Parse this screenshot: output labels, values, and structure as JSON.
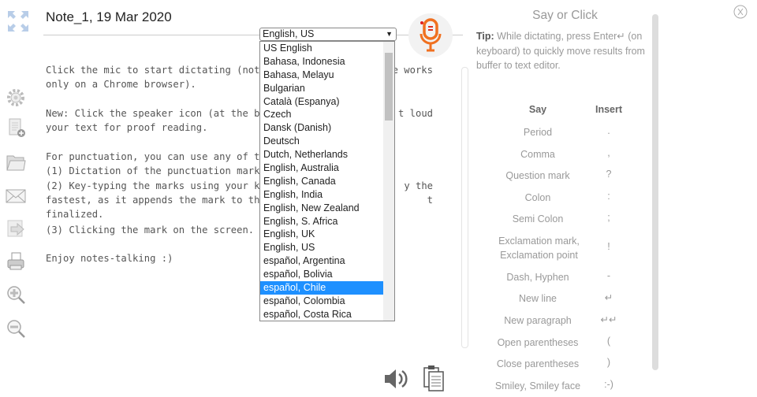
{
  "note": {
    "title": "Note_1, 19 Mar 2020",
    "lines": [
      {
        "l": "Click the mic to start dictating (not",
        "r": "e works"
      },
      {
        "l": "only on a Chrome browser).",
        "r": ""
      },
      {
        "l": "New: Click the speaker icon (at the b",
        "r": "t loud"
      },
      {
        "l": "your text for proof reading.",
        "r": ""
      },
      {
        "l": "For punctuation, you can use any of t",
        "r": ""
      },
      {
        "l": "(1) Dictation of the punctuation mark",
        "r": ""
      },
      {
        "l": "(2) Key-typing the marks using your k",
        "r": "y the"
      },
      {
        "l": "fastest, as it appends the mark to th",
        "r": "t"
      },
      {
        "l": "finalized.",
        "r": ""
      },
      {
        "l": "(3) Clicking the mark on the screen.",
        "r": ""
      },
      {
        "l": "Enjoy notes-talking :)",
        "r": ""
      }
    ]
  },
  "language": {
    "selected": "English, US",
    "highlighted": "español, Chile",
    "options": [
      "US English",
      "Bahasa, Indonesia",
      "Bahasa, Melayu",
      "Bulgarian",
      "Català (Espanya)",
      "Czech",
      "Dansk (Danish)",
      "Deutsch",
      "Dutch, Netherlands",
      "English, Australia",
      "English, Canada",
      "English, India",
      "English, New Zealand",
      "English, S. Africa",
      "English, UK",
      "English, US",
      "español, Argentina",
      "español, Bolivia",
      "español, Chile",
      "español, Colombia",
      "español, Costa Rica"
    ]
  },
  "panel": {
    "title": "Say or Click",
    "tip_label": "Tip:",
    "tip_text": " While dictating, press Enter↵ (on keyboard) to quickly move results from buffer to text editor.",
    "col_say": "Say",
    "col_insert": "Insert",
    "rows": [
      {
        "say": "Period",
        "insert": "."
      },
      {
        "say": "Comma",
        "insert": ","
      },
      {
        "say": "Question mark",
        "insert": "?"
      },
      {
        "say": "Colon",
        "insert": ":"
      },
      {
        "say": "Semi Colon",
        "insert": ";"
      },
      {
        "say": "Exclamation mark, Exclamation point",
        "insert": "!"
      },
      {
        "say": "Dash, Hyphen",
        "insert": "-"
      },
      {
        "say": "New line",
        "insert": "↵"
      },
      {
        "say": "New paragraph",
        "insert": "↵↵"
      },
      {
        "say": "Open parentheses",
        "insert": "("
      },
      {
        "say": "Close parentheses",
        "insert": ")"
      },
      {
        "say": "Smiley, Smiley face",
        "insert": ":-)"
      }
    ]
  },
  "colors": {
    "mic": "#f07020",
    "highlight": "#1e90ff"
  }
}
